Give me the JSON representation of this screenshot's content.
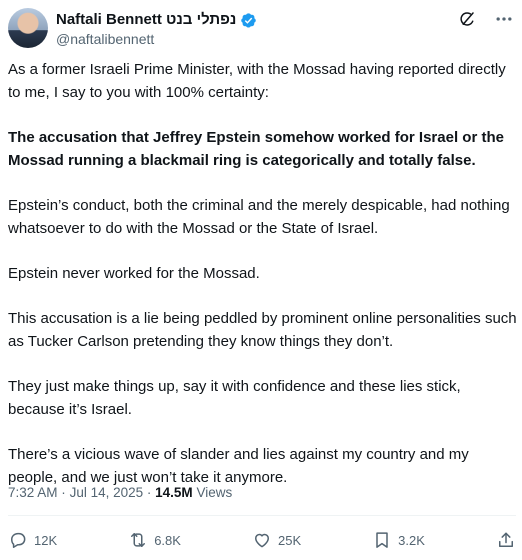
{
  "author": {
    "display_name": "Naftali Bennett נפתלי בנט",
    "handle": "@naftalibennett",
    "verified": true
  },
  "tweet": {
    "paragraphs": [
      {
        "text": "As a former Israeli Prime Minister, with the Mossad having reported directly to me, I say to you with 100% certainty:",
        "bold": false
      },
      {
        "text": "The accusation that Jeffrey Epstein somehow worked for Israel or the Mossad running a blackmail ring is categorically and totally false.",
        "bold": true
      },
      {
        "text": "Epstein’s conduct, both the criminal and the merely despicable, had nothing whatsoever to do with the Mossad or the State of Israel.",
        "bold": false
      },
      {
        "text": "Epstein never worked for the Mossad.",
        "bold": false
      },
      {
        "text": "This accusation is a lie being peddled by prominent online personalities such as Tucker Carlson pretending they know things they don’t.",
        "bold": false
      },
      {
        "text": "They just make things up, say it with confidence and these lies stick, because it’s Israel.",
        "bold": false
      },
      {
        "text": "There’s a vicious wave of slander and lies against my country and my people, and we just won’t take it anymore.",
        "bold": false
      }
    ],
    "time": "7:32 AM",
    "separator": "·",
    "date": "Jul 14, 2025",
    "views_count": "14.5M",
    "views_label": "Views"
  },
  "actions": {
    "replies": "12K",
    "reposts": "6.8K",
    "likes": "25K",
    "bookmarks": "3.2K"
  },
  "icons": {
    "verified": "verified-badge-icon",
    "grok": "grok-icon",
    "more": "more-icon",
    "reply": "reply-icon",
    "repost": "repost-icon",
    "like": "like-icon",
    "bookmark": "bookmark-icon",
    "share": "share-icon"
  },
  "colors": {
    "text": "#0f1419",
    "secondary": "#536471",
    "verified": "#1d9bf0",
    "divider": "#eff3f4"
  }
}
